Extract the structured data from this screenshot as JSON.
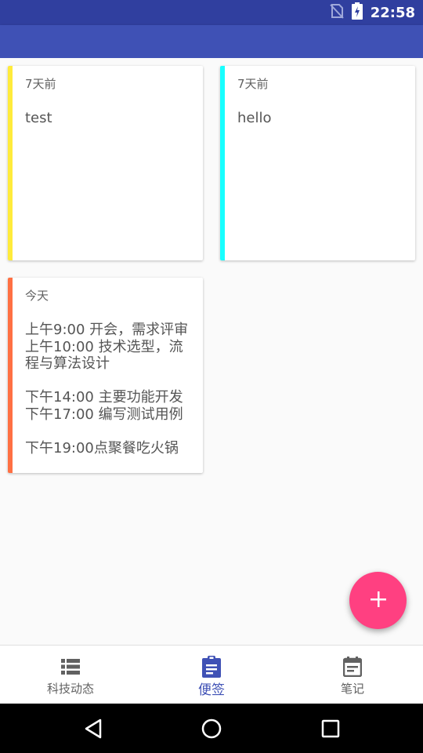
{
  "status_bar": {
    "time": "22:58",
    "icons": [
      "no-sim-icon",
      "battery-charging-icon"
    ]
  },
  "notes": [
    {
      "date": "7天前",
      "body": "test",
      "color": "#ffeb3b"
    },
    {
      "date": "7天前",
      "body": "hello",
      "color": "#18ffff"
    },
    {
      "date": "今天",
      "body": "上午9:00 开会，需求评审\n上午10:00 技术选型，流程与算法设计\n\n下午14:00 主要功能开发\n下午17:00 编写测试用例\n\n下午19:00点聚餐吃火锅",
      "color": "#ff7043"
    }
  ],
  "fab": {
    "icon": "add-icon",
    "color": "#ff4081"
  },
  "bottom_nav": {
    "items": [
      {
        "label": "科技动态",
        "icon": "list-icon"
      },
      {
        "label": "便签",
        "icon": "clipboard-icon",
        "active": true
      },
      {
        "label": "笔记",
        "icon": "calendar-note-icon"
      }
    ],
    "active_color": "#3f51b5"
  },
  "system_nav": [
    "back-icon",
    "home-icon",
    "recents-icon"
  ],
  "colors": {
    "primary": "#3f51b5",
    "primary_dark": "#303f9f"
  }
}
